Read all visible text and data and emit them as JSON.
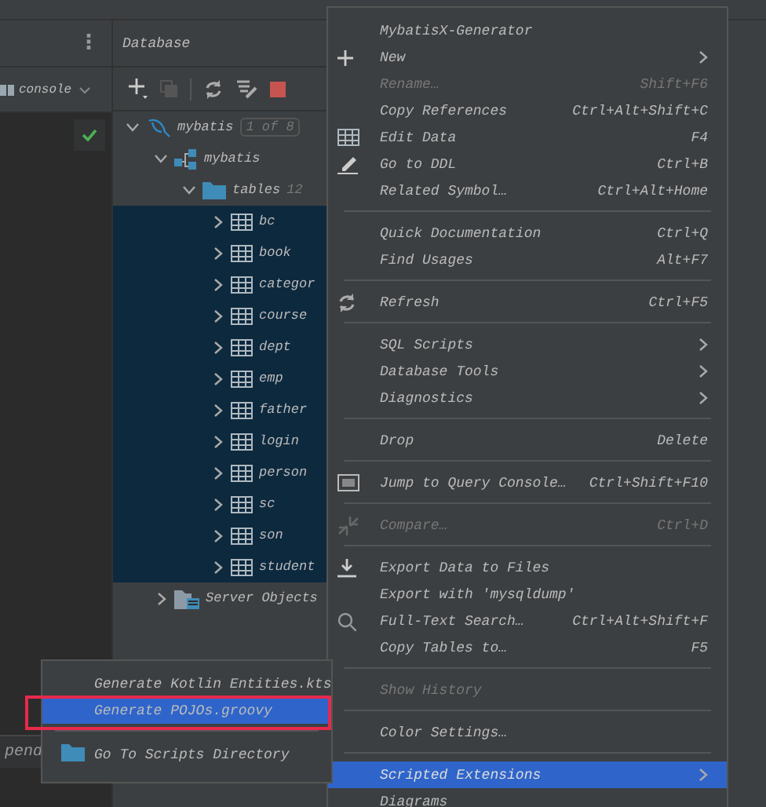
{
  "left_panel": {
    "menu_icon": "⋮",
    "console": {
      "label": "console"
    },
    "status_text": "pend"
  },
  "database_panel": {
    "title": "Database",
    "tree": [
      {
        "label": "mybatis",
        "badge": "1 of 8",
        "kind": "datasource",
        "expanded": true,
        "selected": false,
        "children": [
          {
            "label": "mybatis",
            "kind": "schema",
            "expanded": true,
            "selected": false,
            "children": [
              {
                "label": "tables",
                "count": "12",
                "kind": "folder",
                "expanded": true,
                "selected": false,
                "children": [
                  {
                    "label": "bc",
                    "kind": "table",
                    "expanded": false,
                    "selected": true
                  },
                  {
                    "label": "book",
                    "kind": "table",
                    "expanded": false,
                    "selected": true
                  },
                  {
                    "label": "categor",
                    "kind": "table",
                    "expanded": false,
                    "selected": true
                  },
                  {
                    "label": "course",
                    "kind": "table",
                    "expanded": false,
                    "selected": true
                  },
                  {
                    "label": "dept",
                    "kind": "table",
                    "expanded": false,
                    "selected": true
                  },
                  {
                    "label": "emp",
                    "kind": "table",
                    "expanded": false,
                    "selected": true
                  },
                  {
                    "label": "father",
                    "kind": "table",
                    "expanded": false,
                    "selected": true
                  },
                  {
                    "label": "login",
                    "kind": "table",
                    "expanded": false,
                    "selected": true
                  },
                  {
                    "label": "person",
                    "kind": "table",
                    "expanded": false,
                    "selected": true
                  },
                  {
                    "label": "sc",
                    "kind": "table",
                    "expanded": false,
                    "selected": true
                  },
                  {
                    "label": "son",
                    "kind": "table",
                    "expanded": false,
                    "selected": true
                  },
                  {
                    "label": "student",
                    "kind": "table",
                    "expanded": false,
                    "selected": true
                  }
                ]
              }
            ]
          },
          {
            "label": "Server Objects",
            "kind": "server",
            "expanded": false,
            "selected": false
          }
        ]
      }
    ]
  },
  "context_menu": {
    "items": [
      {
        "kind": "item",
        "label": "MybatisX-Generator",
        "disabled": false,
        "selected": false
      },
      {
        "kind": "item",
        "label": "New",
        "submenu": true,
        "disabled": false,
        "selected": false
      },
      {
        "kind": "item",
        "label": "Rename…",
        "shortcut": "Shift+F6",
        "disabled": true,
        "selected": false
      },
      {
        "kind": "item",
        "label": "Copy References",
        "shortcut": "Ctrl+Alt+Shift+C",
        "disabled": false,
        "selected": false
      },
      {
        "kind": "item",
        "label": "Edit Data",
        "shortcut": "F4",
        "disabled": false,
        "selected": false
      },
      {
        "kind": "item",
        "label": "Go to DDL",
        "shortcut": "Ctrl+B",
        "disabled": false,
        "selected": false
      },
      {
        "kind": "item",
        "label": "Related Symbol…",
        "shortcut": "Ctrl+Alt+Home",
        "disabled": false,
        "selected": false
      },
      {
        "kind": "separator"
      },
      {
        "kind": "item",
        "label": "Quick Documentation",
        "shortcut": "Ctrl+Q",
        "disabled": false,
        "selected": false
      },
      {
        "kind": "item",
        "label": "Find Usages",
        "shortcut": "Alt+F7",
        "disabled": false,
        "selected": false
      },
      {
        "kind": "separator"
      },
      {
        "kind": "item",
        "label": "Refresh",
        "shortcut": "Ctrl+F5",
        "disabled": false,
        "selected": false
      },
      {
        "kind": "separator"
      },
      {
        "kind": "item",
        "label": "SQL Scripts",
        "submenu": true,
        "disabled": false,
        "selected": false
      },
      {
        "kind": "item",
        "label": "Database Tools",
        "submenu": true,
        "disabled": false,
        "selected": false
      },
      {
        "kind": "item",
        "label": "Diagnostics",
        "submenu": true,
        "disabled": false,
        "selected": false
      },
      {
        "kind": "separator"
      },
      {
        "kind": "item",
        "label": "Drop",
        "shortcut": "Delete",
        "disabled": false,
        "selected": false
      },
      {
        "kind": "separator"
      },
      {
        "kind": "item",
        "label": "Jump to Query Console…",
        "shortcut": "Ctrl+Shift+F10",
        "disabled": false,
        "selected": false
      },
      {
        "kind": "separator"
      },
      {
        "kind": "item",
        "label": "Compare…",
        "shortcut": "Ctrl+D",
        "disabled": true,
        "selected": false
      },
      {
        "kind": "separator"
      },
      {
        "kind": "item",
        "label": "Export Data to Files",
        "disabled": false,
        "selected": false
      },
      {
        "kind": "item",
        "label": "Export with 'mysqldump'",
        "disabled": false,
        "selected": false
      },
      {
        "kind": "item",
        "label": "Full-Text Search…",
        "shortcut": "Ctrl+Alt+Shift+F",
        "disabled": false,
        "selected": false
      },
      {
        "kind": "item",
        "label": "Copy Tables to…",
        "shortcut": "F5",
        "disabled": false,
        "selected": false
      },
      {
        "kind": "separator"
      },
      {
        "kind": "item",
        "label": "Show History",
        "disabled": true,
        "selected": false
      },
      {
        "kind": "separator"
      },
      {
        "kind": "item",
        "label": "Color Settings…",
        "disabled": false,
        "selected": false
      },
      {
        "kind": "separator"
      },
      {
        "kind": "item",
        "label": "Scripted Extensions",
        "submenu": true,
        "disabled": false,
        "selected": true
      },
      {
        "kind": "item",
        "label": "Diagrams",
        "disabled": false,
        "selected": false
      }
    ]
  },
  "submenu": {
    "items": [
      {
        "kind": "item",
        "label": "Generate Kotlin Entities.kts",
        "selected": false,
        "highlighted": false
      },
      {
        "kind": "item",
        "label": "Generate POJOs.groovy",
        "selected": true,
        "highlighted": true
      },
      {
        "kind": "separator"
      },
      {
        "kind": "item",
        "label": "Go To Scripts Directory",
        "selected": false,
        "highlighted": false
      }
    ]
  }
}
